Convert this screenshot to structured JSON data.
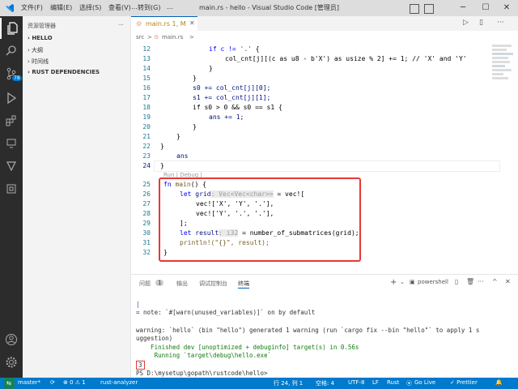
{
  "titlebar": {
    "menus": [
      "文件(F)",
      "编辑(E)",
      "选择(S)",
      "查看(V)",
      "…",
      "转到(G)",
      "…"
    ],
    "title": "main.rs - hello - Visual Studio Code [管理员]"
  },
  "sidebar": {
    "header": "资源管理器",
    "sections": [
      "HELLO",
      "大纲",
      "时间线",
      "RUST DEPENDENCIES"
    ]
  },
  "activity": {
    "badge": "78"
  },
  "tab": {
    "label": "main.rs 1, M"
  },
  "breadcrumb": {
    "folder": "src",
    "sep": ">",
    "file": "main.rs",
    "sep2": ">"
  },
  "editor": {
    "line_numbers": [
      "12",
      "13",
      "14",
      "15",
      "16",
      "17",
      "18",
      "19",
      "20",
      "21",
      "22",
      "23",
      "24",
      "25",
      "26",
      "27",
      "28",
      "29",
      "30",
      "31",
      "32"
    ],
    "codelens": "Run | Debug |",
    "code": {
      "l12_a": "if c != ",
      "l12_b": "'.'",
      "l12_c": " {",
      "l13_a": "col_cnt[j][(c as u8 - b'X') as usize % 2] += 1; // 'X' and 'Y'",
      "l14": "}",
      "l15": "}",
      "l16": "s0 += col_cnt[j][0];",
      "l17": "s1 += col_cnt[j][1];",
      "l18": "if s0 > 0 && s0 == s1 {",
      "l19": "ans += 1;",
      "l20": "}",
      "l21": "}",
      "l22": "}",
      "l23": "ans",
      "l24": "}",
      "l25_kw": "fn",
      "l25_fn": " main",
      "l25_rest": "() {",
      "l26_kw": "let",
      "l26_var": " grid",
      "l26_hint": ": Vec<Vec<char>>",
      "l26_rest": " = vec![",
      "l27": "vec!['X', 'Y', '.'],",
      "l28": "vec!['Y', '.', '.'],",
      "l29": "];",
      "l30_kw": "let",
      "l30_var": " result",
      "l30_hint": ": i32",
      "l30_rest": " = number_of_submatrices(grid);",
      "l31": "println!(\"{}\", result);",
      "l32": "}"
    }
  },
  "panel": {
    "tabs": [
      "问题",
      "1",
      "输出",
      "调试控制台",
      "终端"
    ],
    "shell": "powershell",
    "lines": [
      "|",
      "= note: `#[warn(unused_variables)]` on by default",
      "",
      "warning: `hello` (bin \"hello\") generated 1 warning (run `cargo fix --bin \"hello\"` to apply 1 s",
      "uggestion)",
      "    Finished dev [unoptimized + debuginfo] target(s) in 0.56s",
      "     Running `target\\debug\\hello.exe`",
      "3",
      "PS D:\\mysetup\\gopath\\rustcode\\hello> "
    ]
  },
  "status": {
    "branch": "master*",
    "sync": "⟳",
    "problems": "⊗ 0 ⚠ 1",
    "analyzer": "rust-analyzer",
    "position": "行 24, 列 1",
    "spaces": "空格: 4",
    "encoding": "UTF-8",
    "eol": "LF",
    "lang": "Rust",
    "golive": "Go Live",
    "prettier": "✓ Prettier"
  },
  "colors": {
    "accent": "#007acc",
    "highlight_box": "#e53935"
  }
}
